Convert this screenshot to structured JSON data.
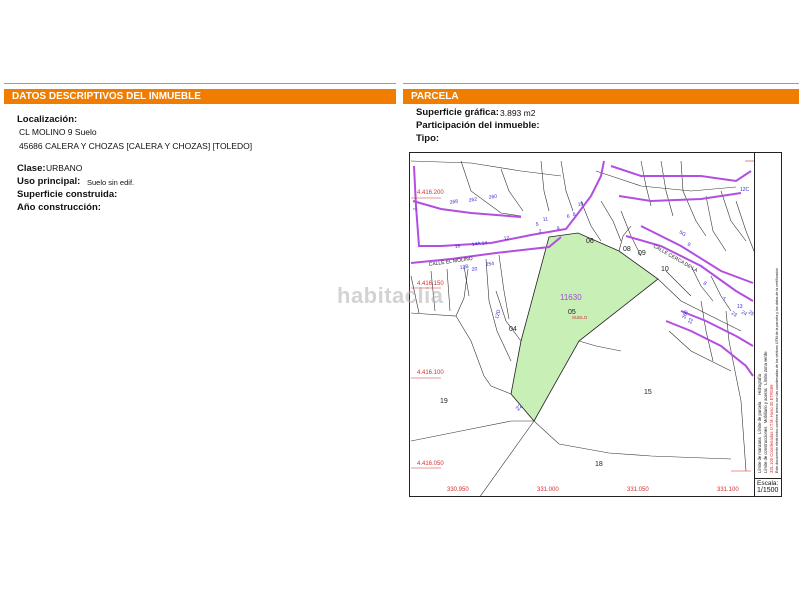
{
  "left_section": {
    "header": "DATOS DESCRIPTIVOS DEL INMUEBLE",
    "localizacion_label": "Localización:",
    "localizacion_line1": "CL MOLINO 9 Suelo",
    "localizacion_line2": "45686 CALERA Y CHOZAS [CALERA Y CHOZAS] [TOLEDO]",
    "clase_label": "Clase:",
    "clase_value": "URBANO",
    "uso_label": "Uso principal:",
    "uso_value": "Suelo sin edif.",
    "superficie_label": "Superficie construida:",
    "anio_label": "Año construcción:"
  },
  "right_section": {
    "header": "PARCELA",
    "superficie_label": "Superficie gráfica:",
    "superficie_value": "3.893 m2",
    "participacion_label": "Participación del inmueble:",
    "tipo_label": "Tipo:"
  },
  "map": {
    "parcel_fill": "#c8efb5",
    "parcel_ref": "11630",
    "parcel_number": "05",
    "parcel_tag": "SUELO",
    "plot_labels": [
      "04",
      "06",
      "08",
      "09",
      "10",
      "15",
      "18",
      "19",
      "22"
    ],
    "street_labels": [
      "CALLE EL MOLINO",
      "CALLE CERCA DE LA"
    ],
    "house_numbers": [
      "268",
      "262",
      "260",
      "16",
      "14A",
      "14",
      "12",
      "2",
      "11",
      "9",
      "6",
      "8",
      "10",
      "5",
      "1",
      "254",
      "20",
      "12B",
      "12D",
      "12C",
      "5G",
      "9",
      "8",
      "7",
      "13",
      "260",
      "22",
      "23",
      "24",
      "25"
    ],
    "northings": [
      "4.416.200",
      "4.416.150",
      "4.416.100",
      "4.416.050"
    ],
    "eastings": [
      "330.950",
      "331.000",
      "331.050",
      "331.100"
    ],
    "watermark": "habitaclia",
    "legend_items": [
      "Límite de manzana",
      "Límite de parcela",
      "Límite de construcciones",
      "Mobiliario y aceras",
      "Límite zona verde",
      "Hidrografía"
    ],
    "legend_note_red": "331.100 Coordenadas U.T.M. Huso 30 ETRS89",
    "legend_note": "Este documento electrónico contiene anexo con las coordenadas de los vértices UTM de la parcela y los datos de la certificación",
    "scale_label": "Escala:",
    "scale_value": "1/1500"
  }
}
